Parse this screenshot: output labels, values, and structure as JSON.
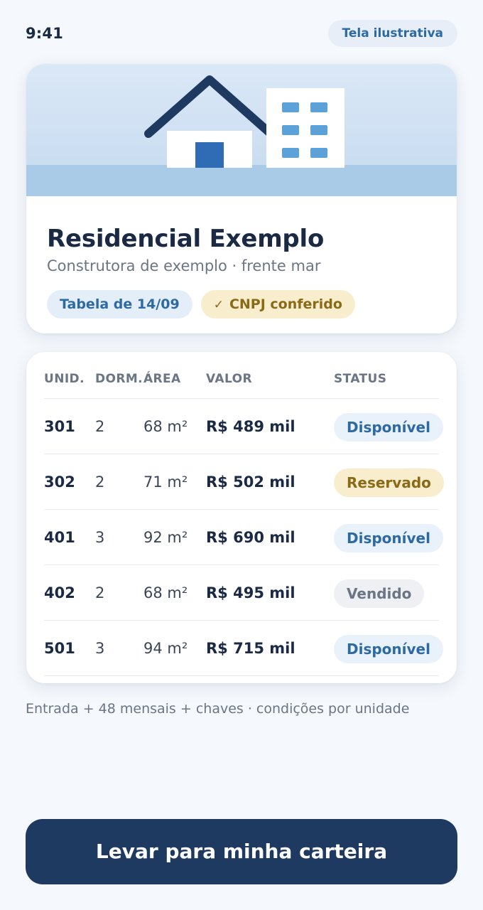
{
  "status_bar": {
    "time": "9:41",
    "badge": "Tela ilustrativa"
  },
  "project": {
    "title": "Residencial Exemplo",
    "subtitle": "Construtora de exemplo · frente mar",
    "tags": {
      "table_date": "Tabela de 14/09",
      "cnpj": "CNPJ conferido"
    }
  },
  "table": {
    "headers": {
      "unit": "UNID.",
      "bedrooms": "DORM.",
      "area": "ÁREA",
      "price": "VALOR",
      "status": "STATUS"
    },
    "rows": [
      {
        "unit": "301",
        "bedrooms": "2",
        "area": "68 m²",
        "price": "R$ 489 mil",
        "status": "Disponível",
        "status_kind": "available"
      },
      {
        "unit": "302",
        "bedrooms": "2",
        "area": "71 m²",
        "price": "R$ 502 mil",
        "status": "Reservado",
        "status_kind": "reserved"
      },
      {
        "unit": "401",
        "bedrooms": "3",
        "area": "92 m²",
        "price": "R$ 690 mil",
        "status": "Disponível",
        "status_kind": "available"
      },
      {
        "unit": "402",
        "bedrooms": "2",
        "area": "68 m²",
        "price": "R$ 495 mil",
        "status": "Vendido",
        "status_kind": "sold"
      },
      {
        "unit": "501",
        "bedrooms": "3",
        "area": "94 m²",
        "price": "R$ 715 mil",
        "status": "Disponível",
        "status_kind": "available"
      }
    ]
  },
  "footnote": "Entrada + 48 mensais + chaves · condições por unidade",
  "cta": {
    "label": "Levar para minha carteira"
  },
  "icons": {
    "hero": "house-and-building-illustration",
    "check": "check-icon"
  },
  "colors": {
    "primary": "#1e3a60",
    "accent_blue": "#2d6aa3",
    "accent_gold": "#8a6a16",
    "background": "#f5f8fc"
  }
}
